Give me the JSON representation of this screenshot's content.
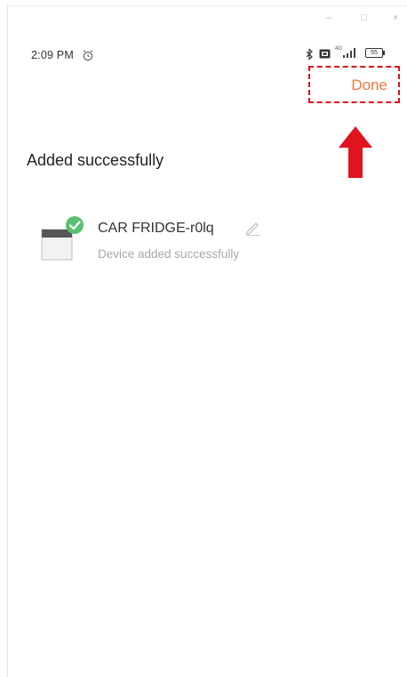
{
  "window_controls": {
    "minimize": "–",
    "maximize": "□",
    "close": "×"
  },
  "status_bar": {
    "time": "2:09 PM",
    "network_label": "4G",
    "battery_level": "55",
    "icons": [
      "alarm-icon",
      "bluetooth-icon",
      "hd-icon",
      "signal-icon",
      "battery-icon"
    ]
  },
  "header": {
    "done_label": "Done"
  },
  "page": {
    "heading": "Added successfully"
  },
  "device": {
    "name": "CAR FRIDGE-r0lq",
    "status": "Device added successfully"
  },
  "colors": {
    "done_text": "#f0773a",
    "highlight_border": "#e0141e",
    "arrow": "#e0141e",
    "check_badge": "#5bbf72",
    "secondary_text": "#a8a8a8"
  }
}
